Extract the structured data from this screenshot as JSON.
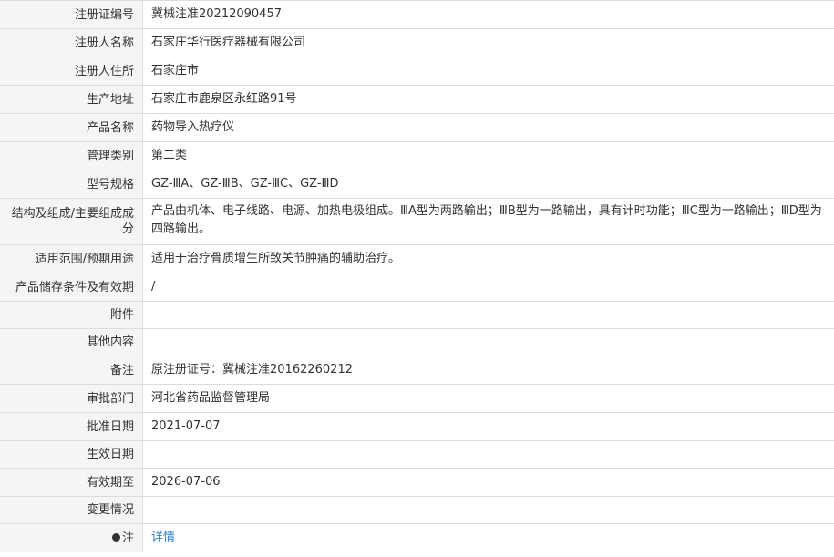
{
  "rows": [
    {
      "label": "注册证编号",
      "value": "冀械注准20212090457"
    },
    {
      "label": "注册人名称",
      "value": "石家庄华行医疗器械有限公司"
    },
    {
      "label": "注册人住所",
      "value": "石家庄市"
    },
    {
      "label": "生产地址",
      "value": "石家庄市鹿泉区永红路91号"
    },
    {
      "label": "产品名称",
      "value": "药物导入热疗仪"
    },
    {
      "label": "管理类别",
      "value": "第二类"
    },
    {
      "label": "型号规格",
      "value": "GZ-ⅢA、GZ-ⅢB、GZ-ⅢC、GZ-ⅢD"
    },
    {
      "label": "结构及组成/主要组成成分",
      "value": "产品由机体、电子线路、电源、加热电极组成。ⅢA型为两路输出；ⅢB型为一路输出，具有计时功能；ⅢC型为一路输出；ⅢD型为四路输出。"
    },
    {
      "label": "适用范围/预期用途",
      "value": "适用于治疗骨质增生所致关节肿痛的辅助治疗。"
    },
    {
      "label": "产品储存条件及有效期",
      "value": "/"
    },
    {
      "label": "附件",
      "value": ""
    },
    {
      "label": "其他内容",
      "value": ""
    },
    {
      "label": "备注",
      "value": "原注册证号：冀械注准20162260212"
    },
    {
      "label": "审批部门",
      "value": "河北省药品监督管理局"
    },
    {
      "label": "批准日期",
      "value": "2021-07-07"
    },
    {
      "label": "生效日期",
      "value": ""
    },
    {
      "label": "有效期至",
      "value": "2026-07-06"
    },
    {
      "label": "变更情况",
      "value": ""
    }
  ],
  "note_row": {
    "label": "注",
    "icon": "pin-icon",
    "link_text": "详情",
    "link_color": "#2a7dc9"
  }
}
